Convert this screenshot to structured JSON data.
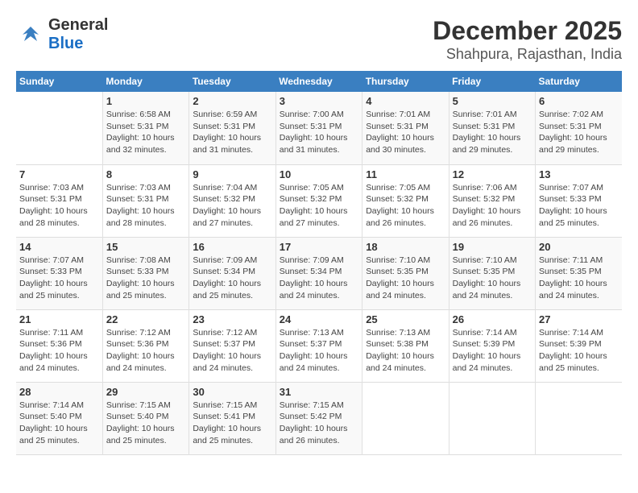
{
  "logo": {
    "general": "General",
    "blue": "Blue"
  },
  "title": "December 2025",
  "subtitle": "Shahpura, Rajasthan, India",
  "days_header": [
    "Sunday",
    "Monday",
    "Tuesday",
    "Wednesday",
    "Thursday",
    "Friday",
    "Saturday"
  ],
  "weeks": [
    [
      {
        "num": "",
        "sunrise": "",
        "sunset": "",
        "daylight": ""
      },
      {
        "num": "1",
        "sunrise": "Sunrise: 6:58 AM",
        "sunset": "Sunset: 5:31 PM",
        "daylight": "Daylight: 10 hours and 32 minutes."
      },
      {
        "num": "2",
        "sunrise": "Sunrise: 6:59 AM",
        "sunset": "Sunset: 5:31 PM",
        "daylight": "Daylight: 10 hours and 31 minutes."
      },
      {
        "num": "3",
        "sunrise": "Sunrise: 7:00 AM",
        "sunset": "Sunset: 5:31 PM",
        "daylight": "Daylight: 10 hours and 31 minutes."
      },
      {
        "num": "4",
        "sunrise": "Sunrise: 7:01 AM",
        "sunset": "Sunset: 5:31 PM",
        "daylight": "Daylight: 10 hours and 30 minutes."
      },
      {
        "num": "5",
        "sunrise": "Sunrise: 7:01 AM",
        "sunset": "Sunset: 5:31 PM",
        "daylight": "Daylight: 10 hours and 29 minutes."
      },
      {
        "num": "6",
        "sunrise": "Sunrise: 7:02 AM",
        "sunset": "Sunset: 5:31 PM",
        "daylight": "Daylight: 10 hours and 29 minutes."
      }
    ],
    [
      {
        "num": "7",
        "sunrise": "Sunrise: 7:03 AM",
        "sunset": "Sunset: 5:31 PM",
        "daylight": "Daylight: 10 hours and 28 minutes."
      },
      {
        "num": "8",
        "sunrise": "Sunrise: 7:03 AM",
        "sunset": "Sunset: 5:31 PM",
        "daylight": "Daylight: 10 hours and 28 minutes."
      },
      {
        "num": "9",
        "sunrise": "Sunrise: 7:04 AM",
        "sunset": "Sunset: 5:32 PM",
        "daylight": "Daylight: 10 hours and 27 minutes."
      },
      {
        "num": "10",
        "sunrise": "Sunrise: 7:05 AM",
        "sunset": "Sunset: 5:32 PM",
        "daylight": "Daylight: 10 hours and 27 minutes."
      },
      {
        "num": "11",
        "sunrise": "Sunrise: 7:05 AM",
        "sunset": "Sunset: 5:32 PM",
        "daylight": "Daylight: 10 hours and 26 minutes."
      },
      {
        "num": "12",
        "sunrise": "Sunrise: 7:06 AM",
        "sunset": "Sunset: 5:32 PM",
        "daylight": "Daylight: 10 hours and 26 minutes."
      },
      {
        "num": "13",
        "sunrise": "Sunrise: 7:07 AM",
        "sunset": "Sunset: 5:33 PM",
        "daylight": "Daylight: 10 hours and 25 minutes."
      }
    ],
    [
      {
        "num": "14",
        "sunrise": "Sunrise: 7:07 AM",
        "sunset": "Sunset: 5:33 PM",
        "daylight": "Daylight: 10 hours and 25 minutes."
      },
      {
        "num": "15",
        "sunrise": "Sunrise: 7:08 AM",
        "sunset": "Sunset: 5:33 PM",
        "daylight": "Daylight: 10 hours and 25 minutes."
      },
      {
        "num": "16",
        "sunrise": "Sunrise: 7:09 AM",
        "sunset": "Sunset: 5:34 PM",
        "daylight": "Daylight: 10 hours and 25 minutes."
      },
      {
        "num": "17",
        "sunrise": "Sunrise: 7:09 AM",
        "sunset": "Sunset: 5:34 PM",
        "daylight": "Daylight: 10 hours and 24 minutes."
      },
      {
        "num": "18",
        "sunrise": "Sunrise: 7:10 AM",
        "sunset": "Sunset: 5:35 PM",
        "daylight": "Daylight: 10 hours and 24 minutes."
      },
      {
        "num": "19",
        "sunrise": "Sunrise: 7:10 AM",
        "sunset": "Sunset: 5:35 PM",
        "daylight": "Daylight: 10 hours and 24 minutes."
      },
      {
        "num": "20",
        "sunrise": "Sunrise: 7:11 AM",
        "sunset": "Sunset: 5:35 PM",
        "daylight": "Daylight: 10 hours and 24 minutes."
      }
    ],
    [
      {
        "num": "21",
        "sunrise": "Sunrise: 7:11 AM",
        "sunset": "Sunset: 5:36 PM",
        "daylight": "Daylight: 10 hours and 24 minutes."
      },
      {
        "num": "22",
        "sunrise": "Sunrise: 7:12 AM",
        "sunset": "Sunset: 5:36 PM",
        "daylight": "Daylight: 10 hours and 24 minutes."
      },
      {
        "num": "23",
        "sunrise": "Sunrise: 7:12 AM",
        "sunset": "Sunset: 5:37 PM",
        "daylight": "Daylight: 10 hours and 24 minutes."
      },
      {
        "num": "24",
        "sunrise": "Sunrise: 7:13 AM",
        "sunset": "Sunset: 5:37 PM",
        "daylight": "Daylight: 10 hours and 24 minutes."
      },
      {
        "num": "25",
        "sunrise": "Sunrise: 7:13 AM",
        "sunset": "Sunset: 5:38 PM",
        "daylight": "Daylight: 10 hours and 24 minutes."
      },
      {
        "num": "26",
        "sunrise": "Sunrise: 7:14 AM",
        "sunset": "Sunset: 5:39 PM",
        "daylight": "Daylight: 10 hours and 24 minutes."
      },
      {
        "num": "27",
        "sunrise": "Sunrise: 7:14 AM",
        "sunset": "Sunset: 5:39 PM",
        "daylight": "Daylight: 10 hours and 25 minutes."
      }
    ],
    [
      {
        "num": "28",
        "sunrise": "Sunrise: 7:14 AM",
        "sunset": "Sunset: 5:40 PM",
        "daylight": "Daylight: 10 hours and 25 minutes."
      },
      {
        "num": "29",
        "sunrise": "Sunrise: 7:15 AM",
        "sunset": "Sunset: 5:40 PM",
        "daylight": "Daylight: 10 hours and 25 minutes."
      },
      {
        "num": "30",
        "sunrise": "Sunrise: 7:15 AM",
        "sunset": "Sunset: 5:41 PM",
        "daylight": "Daylight: 10 hours and 25 minutes."
      },
      {
        "num": "31",
        "sunrise": "Sunrise: 7:15 AM",
        "sunset": "Sunset: 5:42 PM",
        "daylight": "Daylight: 10 hours and 26 minutes."
      },
      {
        "num": "",
        "sunrise": "",
        "sunset": "",
        "daylight": ""
      },
      {
        "num": "",
        "sunrise": "",
        "sunset": "",
        "daylight": ""
      },
      {
        "num": "",
        "sunrise": "",
        "sunset": "",
        "daylight": ""
      }
    ]
  ]
}
